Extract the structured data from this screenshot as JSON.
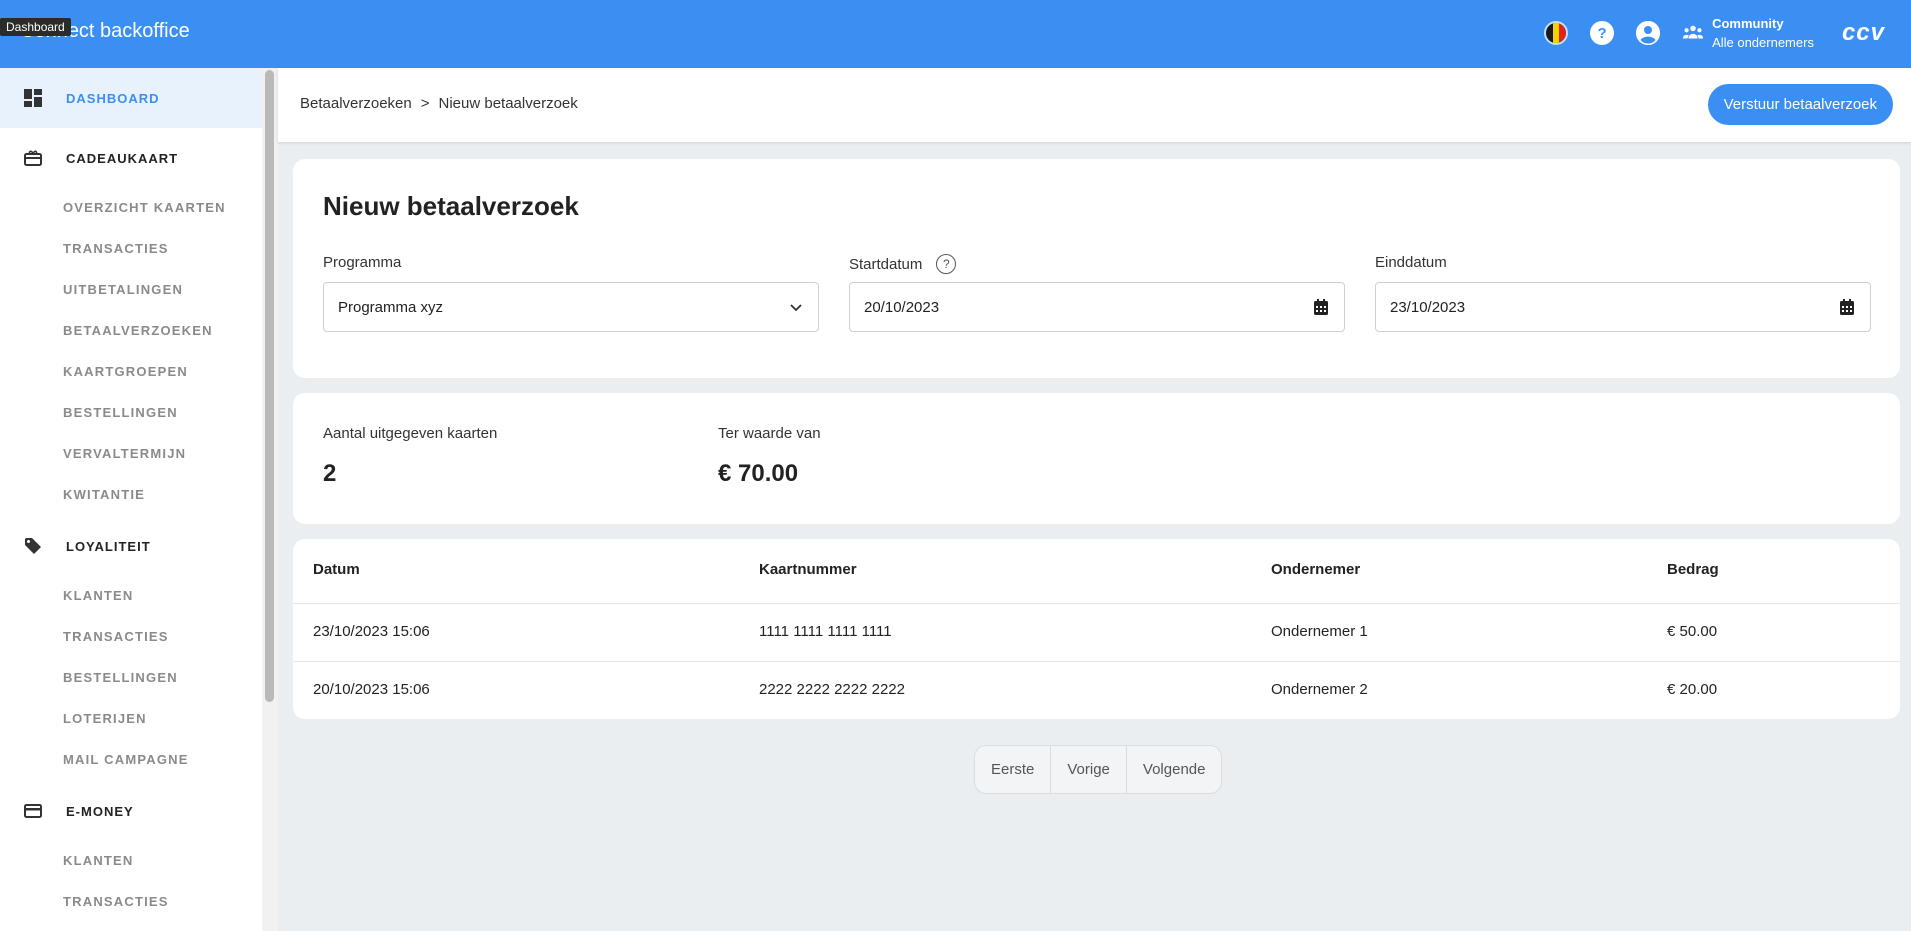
{
  "topbar": {
    "app_title": "Connect backoffice",
    "tooltip": "Dashboard",
    "community_name": "Community",
    "community_sub": "Alle ondernemers",
    "logo": "ccv",
    "help_glyph": "?"
  },
  "sidebar": {
    "dashboard": "DASHBOARD",
    "cadeaukaart": {
      "label": "CADEAUKAART",
      "items": [
        "OVERZICHT KAARTEN",
        "TRANSACTIES",
        "UITBETALINGEN",
        "BETAALVERZOEKEN",
        "KAARTGROEPEN",
        "BESTELLINGEN",
        "VERVALTERMIJN",
        "KWITANTIE"
      ]
    },
    "loyaliteit": {
      "label": "LOYALITEIT",
      "items": [
        "KLANTEN",
        "TRANSACTIES",
        "BESTELLINGEN",
        "LOTERIJEN",
        "MAIL CAMPAGNE"
      ]
    },
    "emoney": {
      "label": "E-MONEY",
      "items": [
        "KLANTEN",
        "TRANSACTIES"
      ]
    }
  },
  "header": {
    "breadcrumb_parent": "Betaalverzoeken",
    "breadcrumb_sep": ">",
    "breadcrumb_current": "Nieuw betaalverzoek",
    "send_button": "Verstuur betaalverzoek"
  },
  "form": {
    "title": "Nieuw betaalverzoek",
    "programma_label": "Programma",
    "programma_value": "Programma xyz",
    "start_label": "Startdatum",
    "start_value": "20/10/2023",
    "end_label": "Einddatum",
    "end_value": "23/10/2023",
    "help_glyph": "?"
  },
  "stats": {
    "cards_label": "Aantal uitgegeven kaarten",
    "cards_value": "2",
    "value_label": "Ter waarde van",
    "value_value": "€ 70.00"
  },
  "table": {
    "headers": [
      "Datum",
      "Kaartnummer",
      "Ondernemer",
      "Bedrag"
    ],
    "rows": [
      [
        "23/10/2023 15:06",
        "1111 1111 1111 1111",
        "Ondernemer 1",
        "€ 50.00"
      ],
      [
        "20/10/2023 15:06",
        "2222 2222 2222 2222",
        "Ondernemer 2",
        "€ 20.00"
      ]
    ]
  },
  "pagination": {
    "first": "Eerste",
    "prev": "Vorige",
    "next": "Volgende"
  },
  "colors": {
    "primary": "#3b8ff3",
    "active_bg": "#e8f2fd"
  }
}
